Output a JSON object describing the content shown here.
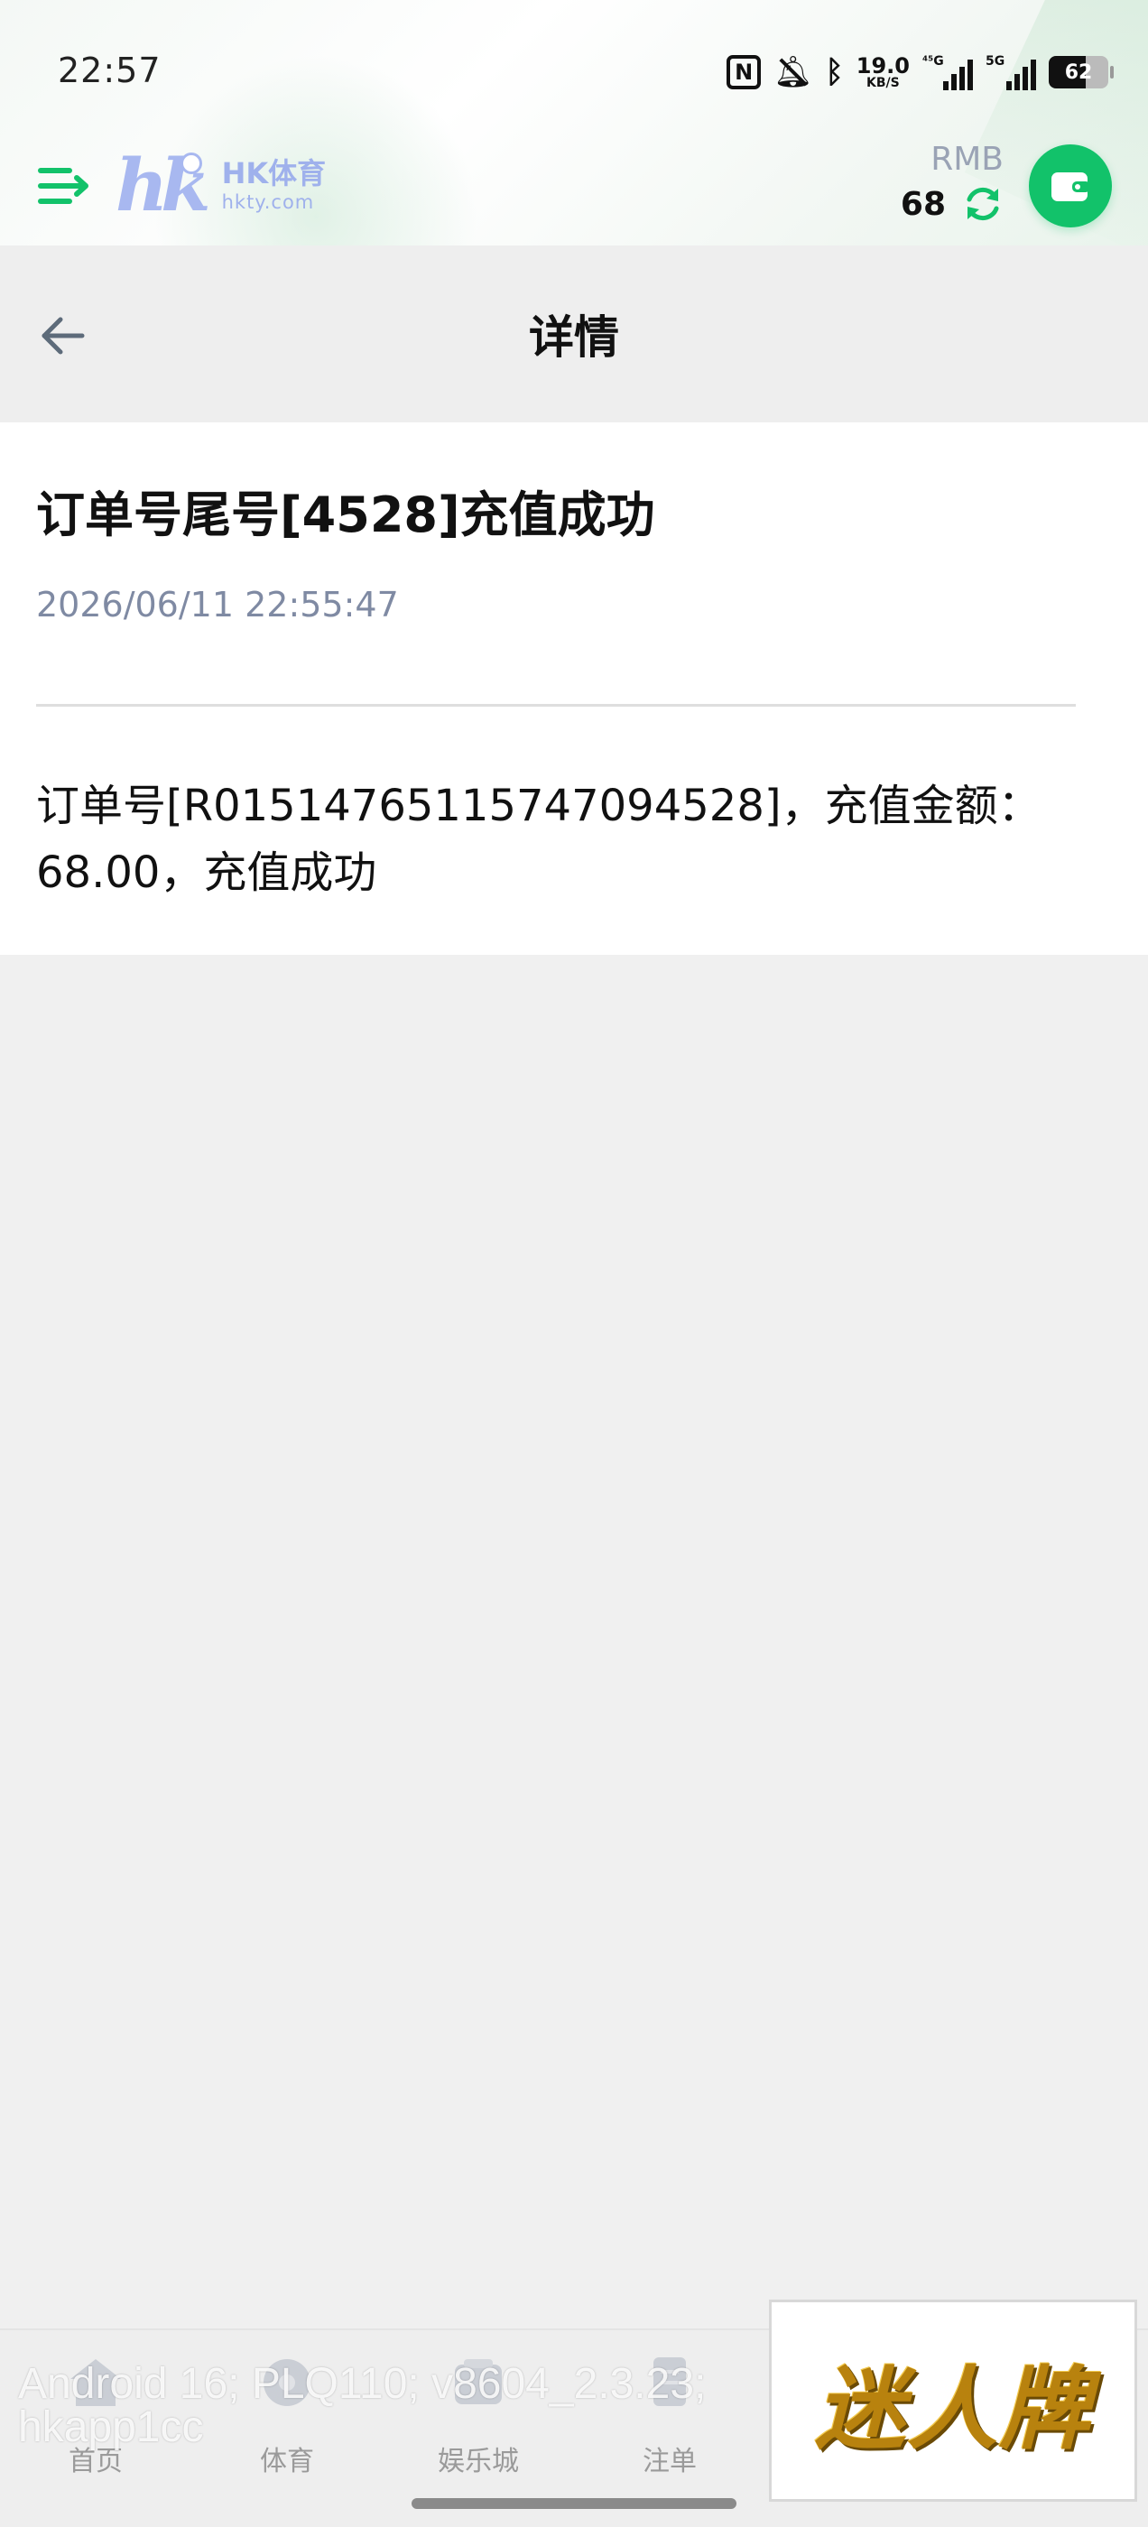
{
  "status_bar": {
    "time": "22:57",
    "net_speed_value": "19.0",
    "net_speed_unit": "KB/S",
    "sim1_tag": "⁴⁵G",
    "sim2_tag": "5G",
    "battery": "62"
  },
  "header": {
    "logo_mark": "hk",
    "logo_name": "HK体育",
    "logo_domain": "hkty.com",
    "currency": "RMB",
    "balance": "68"
  },
  "navbar": {
    "title": "详情"
  },
  "message": {
    "title": "订单号尾号[4528]充值成功",
    "time": "2026/06/11 22:55:47",
    "body": "订单号[R01514765115747094528]，充值金额：68.00，充值成功"
  },
  "tabbar": {
    "items": [
      {
        "label": "首页",
        "icon": "home-icon"
      },
      {
        "label": "体育",
        "icon": "sports-icon"
      },
      {
        "label": "娱乐城",
        "icon": "casino-icon"
      },
      {
        "label": "注单",
        "icon": "bets-icon"
      }
    ]
  },
  "overlay": {
    "text": "Android 16; PLQ110; v8604_2.3.23; hkapp1cc"
  },
  "ad": {
    "text": "迷人牌"
  },
  "colors": {
    "accent": "#12c26a",
    "logo": "#a8b8f0",
    "muted": "#7f8aa3"
  }
}
